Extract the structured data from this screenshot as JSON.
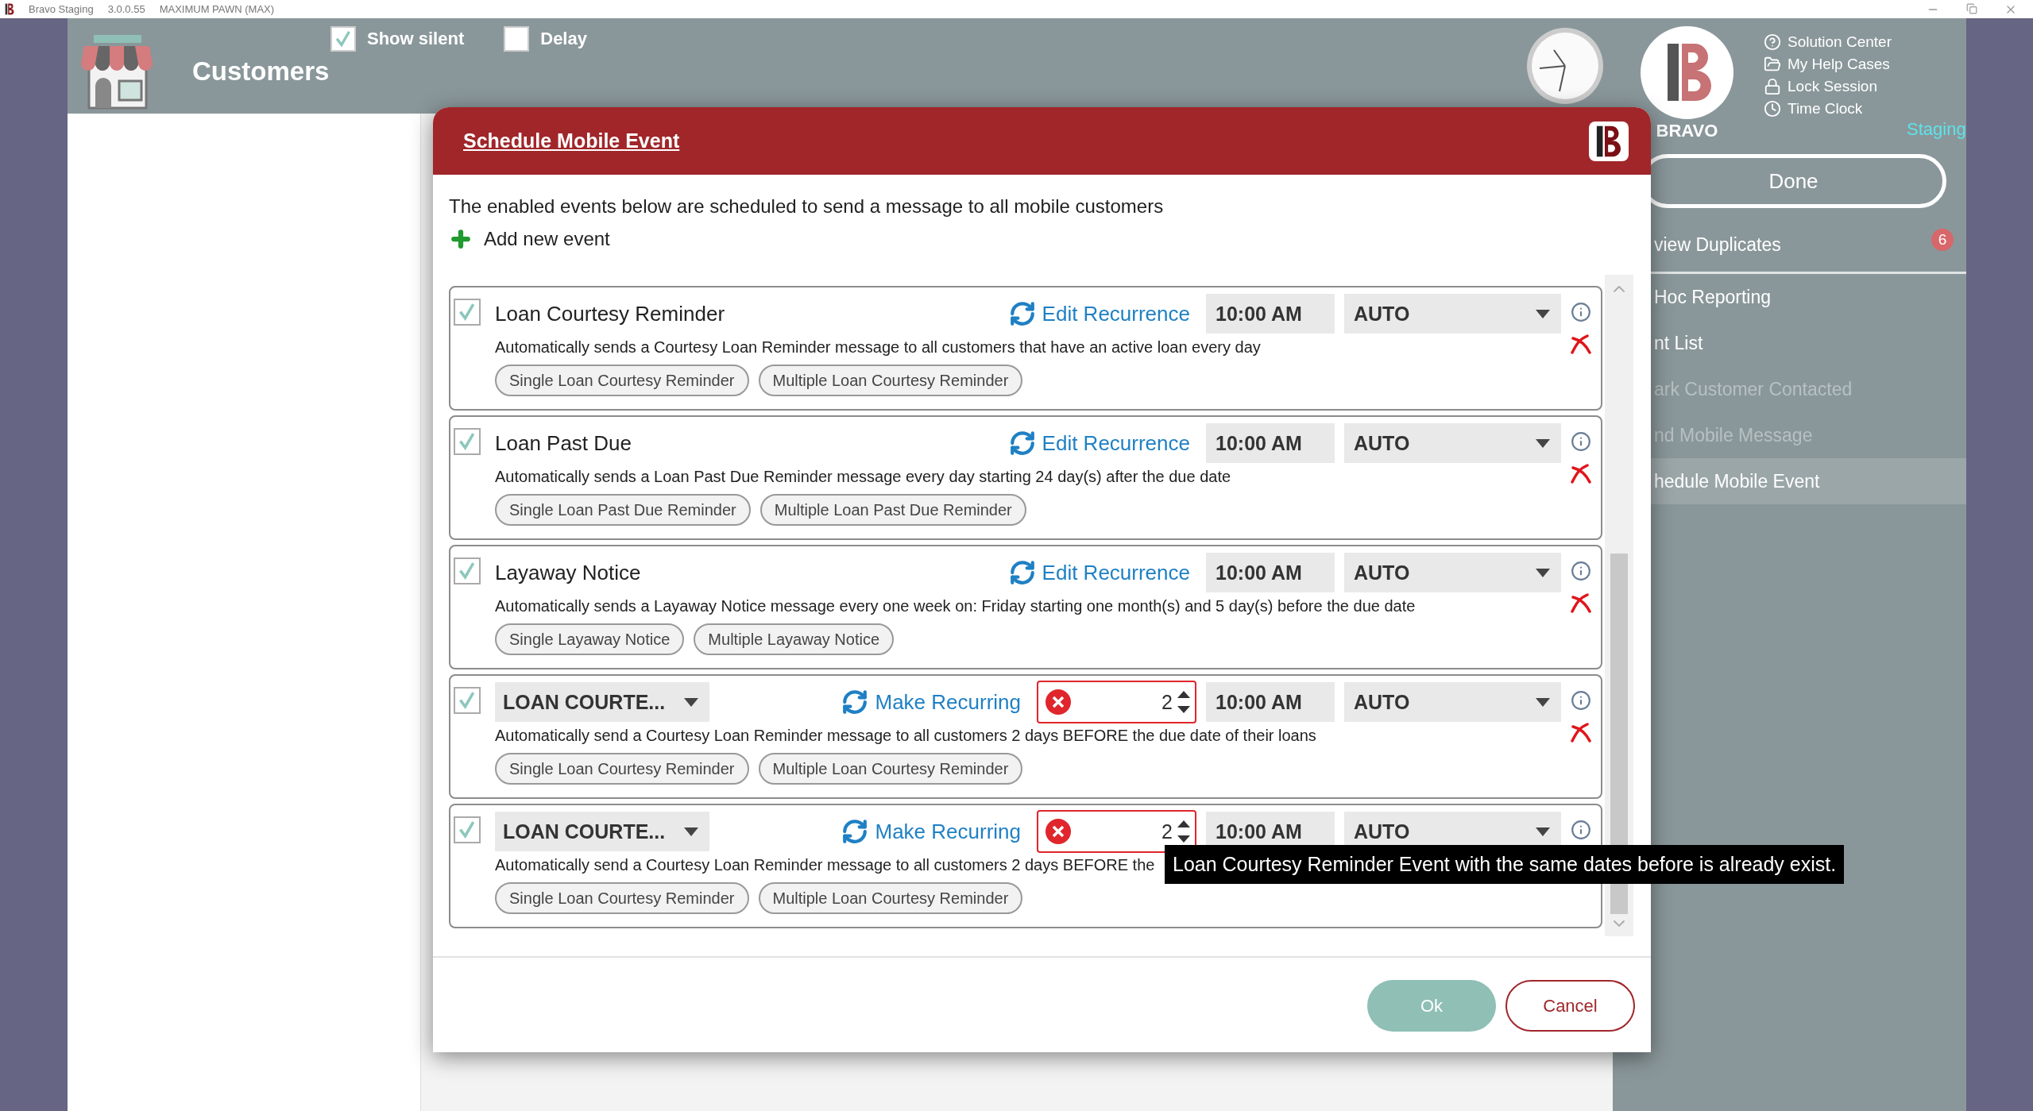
{
  "app_bar": {
    "app_name": "Bravo Staging",
    "version": "3.0.0.55",
    "store": "MAXIMUM PAWN (MAX)"
  },
  "header": {
    "title": "Customers",
    "toggles": [
      {
        "label": "Show silent",
        "checked": true
      },
      {
        "label": "Delay",
        "checked": false
      }
    ],
    "brand": "BRAVO",
    "links": [
      {
        "label": "Solution Center"
      },
      {
        "label": "My Help Cases"
      },
      {
        "label": "Lock Session"
      },
      {
        "label": "Time Clock"
      }
    ],
    "environment": "Staging"
  },
  "side_panel": {
    "done_button": "Done",
    "items": [
      {
        "label": "view Duplicates",
        "badge": "6",
        "disabled": false,
        "selected": false,
        "divider": true
      },
      {
        "label": "Hoc Reporting",
        "disabled": false,
        "selected": false,
        "divider": false
      },
      {
        "label": "nt List",
        "disabled": false,
        "selected": false,
        "divider": false
      },
      {
        "label": "ark Customer Contacted",
        "disabled": true,
        "selected": false,
        "divider": false
      },
      {
        "label": "nd Mobile Message",
        "disabled": true,
        "selected": false,
        "divider": false
      },
      {
        "label": "hedule Mobile Event",
        "disabled": false,
        "selected": true,
        "divider": false
      }
    ]
  },
  "dialog": {
    "title": "Schedule Mobile Event",
    "intro": "The enabled events below are scheduled to send a message to all mobile customers",
    "add_label": "Add new event",
    "events": [
      {
        "kind": "standard",
        "checked": true,
        "name": "Loan Courtesy Reminder",
        "recurrence": "Edit Recurrence",
        "time": "10:00 AM",
        "mode": "AUTO",
        "removable": true,
        "description": "Automatically sends a Courtesy Loan Reminder message to all customers that have an active loan every day",
        "templates": [
          "Single Loan Courtesy Reminder",
          "Multiple Loan Courtesy Reminder"
        ]
      },
      {
        "kind": "standard",
        "checked": true,
        "name": "Loan Past Due",
        "recurrence": "Edit Recurrence",
        "time": "10:00 AM",
        "mode": "AUTO",
        "removable": true,
        "description": "Automatically sends a Loan Past Due Reminder message every day starting 24 day(s) after the due date",
        "templates": [
          "Single Loan Past Due Reminder",
          "Multiple Loan Past Due Reminder"
        ]
      },
      {
        "kind": "standard",
        "checked": true,
        "name": "Layaway Notice",
        "recurrence": "Edit Recurrence",
        "time": "10:00 AM",
        "mode": "AUTO",
        "removable": true,
        "description": "Automatically sends a Layaway Notice message every one week on: Friday starting one month(s) and 5 day(s) before the due date",
        "templates": [
          "Single Layaway Notice",
          "Multiple Layaway Notice"
        ]
      },
      {
        "kind": "custom",
        "checked": true,
        "name": "LOAN COURTE...",
        "recurrence": "Make Recurring",
        "days": "2",
        "invalid": true,
        "time": "10:00 AM",
        "mode": "AUTO",
        "removable": true,
        "description": "Automatically send a Courtesy Loan Reminder message to all customers 2 days BEFORE the due date of their loans",
        "templates": [
          "Single Loan Courtesy Reminder",
          "Multiple Loan Courtesy Reminder"
        ]
      },
      {
        "kind": "custom",
        "checked": true,
        "name": "LOAN COURTE...",
        "recurrence": "Make Recurring",
        "days": "2",
        "invalid": true,
        "time": "10:00 AM",
        "mode": "AUTO",
        "removable": false,
        "description": "Automatically send a Courtesy Loan Reminder message to all customers 2 days BEFORE the",
        "templates": [
          "Single Loan Courtesy Reminder",
          "Multiple Loan Courtesy Reminder"
        ],
        "tooltip": "Loan Courtesy Reminder Event with the same dates before is already exist."
      }
    ],
    "ok": "Ok",
    "cancel": "Cancel"
  }
}
